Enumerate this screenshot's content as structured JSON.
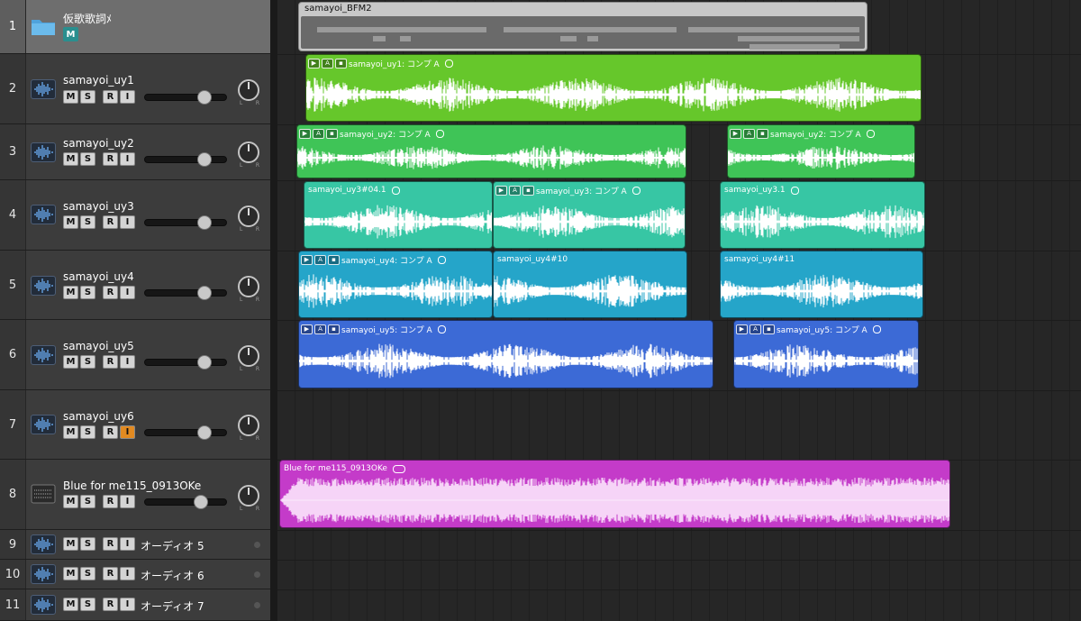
{
  "track_list": [
    {
      "num": "1",
      "name": "仮歌歌詞ﾒ",
      "kind": "folder",
      "folder_button": "M"
    },
    {
      "num": "2",
      "name": "samayoi_uy1",
      "kind": "audio",
      "buttons": [
        "M",
        "S",
        "R",
        "I"
      ],
      "input_enabled": false
    },
    {
      "num": "3",
      "name": "samayoi_uy2",
      "kind": "audio",
      "buttons": [
        "M",
        "S",
        "R",
        "I"
      ],
      "input_enabled": false
    },
    {
      "num": "4",
      "name": "samayoi_uy3",
      "kind": "audio",
      "buttons": [
        "M",
        "S",
        "R",
        "I"
      ],
      "input_enabled": false
    },
    {
      "num": "5",
      "name": "samayoi_uy4",
      "kind": "audio",
      "buttons": [
        "M",
        "S",
        "R",
        "I"
      ],
      "input_enabled": false
    },
    {
      "num": "6",
      "name": "samayoi_uy5",
      "kind": "audio",
      "buttons": [
        "M",
        "S",
        "R",
        "I"
      ],
      "input_enabled": false
    },
    {
      "num": "7",
      "name": "samayoi_uy6",
      "kind": "audio",
      "buttons": [
        "M",
        "S",
        "R",
        "I"
      ],
      "input_enabled": true
    },
    {
      "num": "8",
      "name": "Blue for me115_0913OKe",
      "kind": "audio-stereo",
      "buttons": [
        "M",
        "S",
        "R",
        "I"
      ],
      "input_enabled": false
    },
    {
      "num": "9",
      "name": "オーディオ 5",
      "kind": "audio-small",
      "buttons": [
        "M",
        "S",
        "R",
        "I"
      ]
    },
    {
      "num": "10",
      "name": "オーディオ 6",
      "kind": "audio-small",
      "buttons": [
        "M",
        "S",
        "R",
        "I"
      ]
    },
    {
      "num": "11",
      "name": "オーディオ 7",
      "kind": "audio-small",
      "buttons": [
        "M",
        "S",
        "R",
        "I"
      ]
    }
  ],
  "pan_labels": {
    "left": "L",
    "right": "R"
  },
  "folder_region": {
    "name": "samayoi_BFM2"
  },
  "regions": {
    "uy1": {
      "name": "samayoi_uy1: コンプ A",
      "color": "#66c72b",
      "comp": true
    },
    "uy2a": {
      "name": "samayoi_uy2: コンプ A",
      "color": "#3fc457",
      "comp": true
    },
    "uy2b": {
      "name": "samayoi_uy2: コンプ A",
      "color": "#3fc457",
      "comp": true
    },
    "uy3a": {
      "name": "samayoi_uy3#04.1",
      "color": "#37c6a4",
      "comp": false
    },
    "uy3b": {
      "name": "samayoi_uy3: コンプ A",
      "color": "#37c6a4",
      "comp": true
    },
    "uy3c": {
      "name": "samayoi_uy3.1",
      "color": "#37c6a4",
      "comp": false
    },
    "uy4a": {
      "name": "samayoi_uy4: コンプ A",
      "color": "#25a5c9",
      "comp": true
    },
    "uy4b": {
      "name": "samayoi_uy4#10",
      "color": "#25a5c9",
      "comp": false
    },
    "uy4c": {
      "name": "samayoi_uy4#11",
      "color": "#25a5c9",
      "comp": false
    },
    "uy5a": {
      "name": "samayoi_uy5: コンプ A",
      "color": "#3c6ad6",
      "comp": true
    },
    "uy5b": {
      "name": "samayoi_uy5: コンプ A",
      "color": "#3c6ad6",
      "comp": true
    },
    "blue": {
      "name": "Blue for me115_0913OKe",
      "color": "#c43bc9",
      "comp": false
    }
  },
  "comp_badges": {
    "play": "▶",
    "a": "A",
    "take": "▪"
  },
  "colors": {
    "track_list_bg": "#3c3c3c",
    "arrange_bg": "#262626",
    "input_active": "#e28a21",
    "folder_button": "#2a8f8f"
  }
}
